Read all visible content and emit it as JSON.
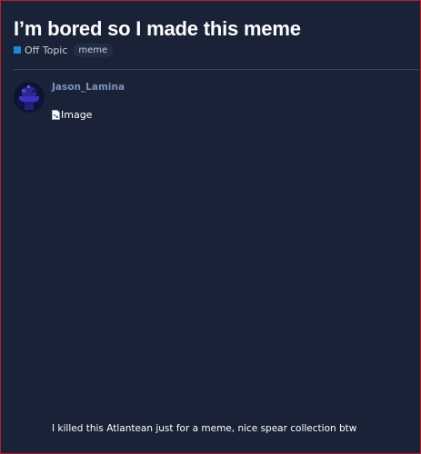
{
  "topic": {
    "title": "I’m bored so I made this meme",
    "category": {
      "label": "Off Topic",
      "color": "#1e88d8"
    },
    "tags": [
      "meme"
    ]
  },
  "post": {
    "username": "Jason_Lamina",
    "avatar_icon": "user-avatar",
    "image_alt": "Image",
    "text": "I killed this Atlantean just for a meme, nice spear collection btw"
  },
  "colors": {
    "background": "#1a2238",
    "border": "#b3202c",
    "divider": "#34466b",
    "username": "#7c93b8"
  }
}
